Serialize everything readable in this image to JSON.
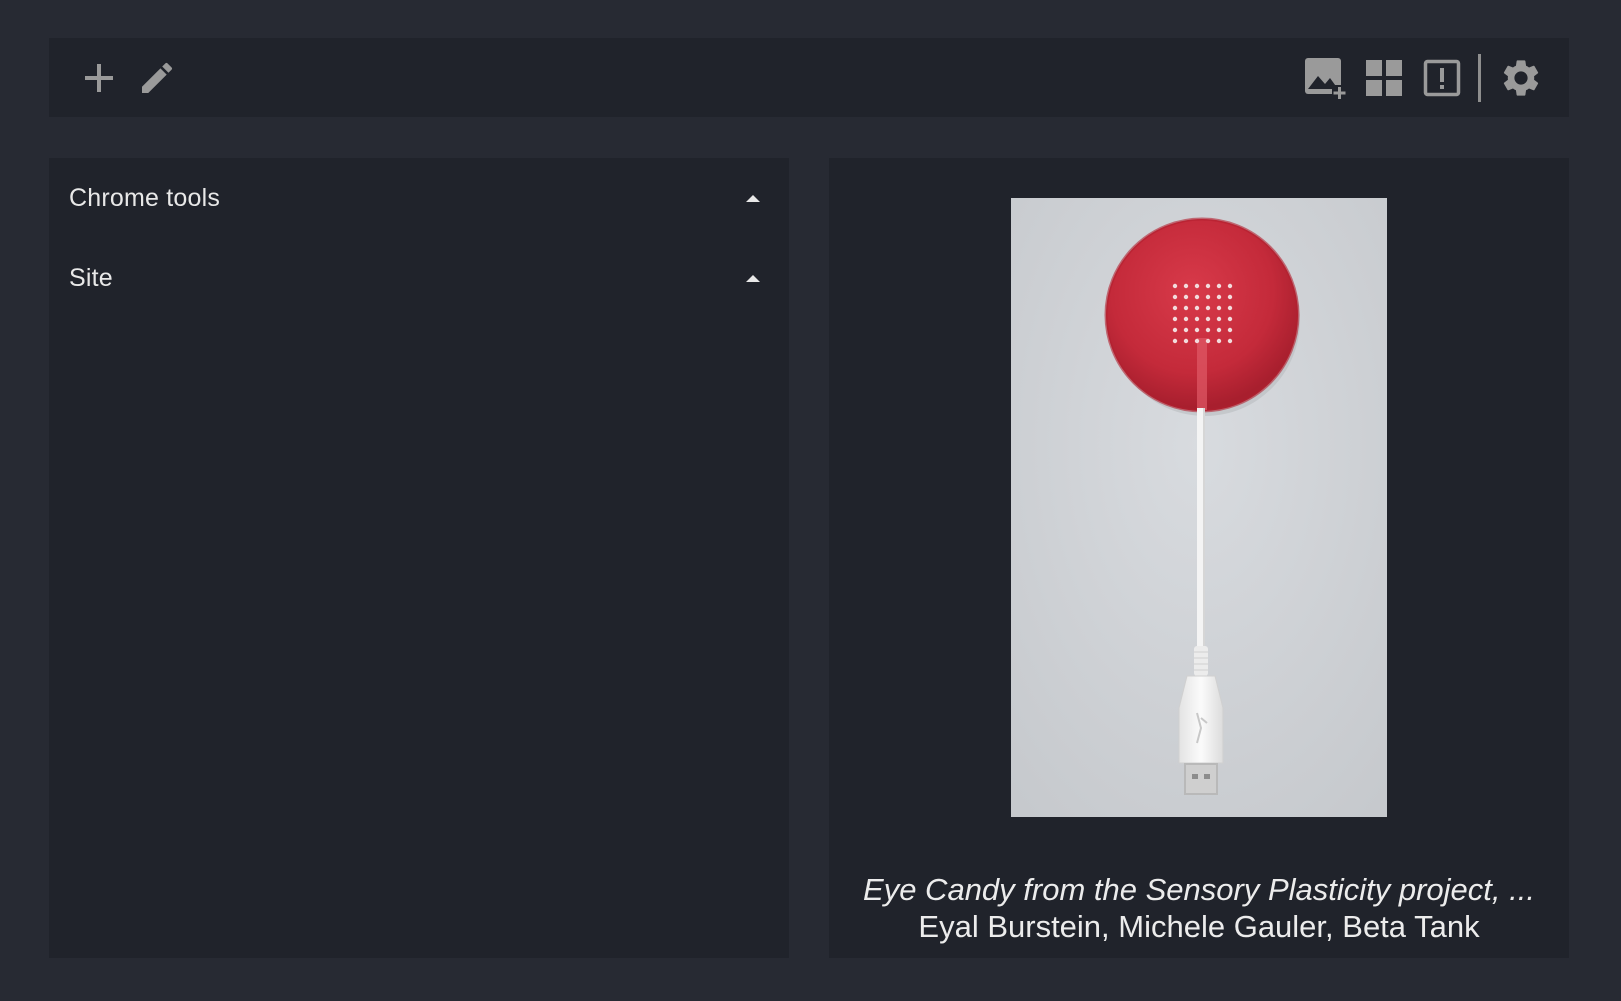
{
  "toolbar": {
    "left_icons": [
      "add-icon",
      "edit-pencil-icon"
    ],
    "right_icons": [
      "add-image-icon",
      "grid-view-icon",
      "report-icon",
      "settings-gear-icon"
    ]
  },
  "sidebar": {
    "sections": [
      {
        "label": "Chrome tools",
        "icon": "caret-up-icon"
      },
      {
        "label": "Site",
        "icon": "caret-up-icon"
      }
    ]
  },
  "artwork": {
    "title": "Eye Candy from the Sensory Plasticity project, ...",
    "artists": "Eyal Burstein, Michele Gauler, Beta Tank",
    "colors": {
      "background": "#cfd2d6",
      "candy": "#c92d3d",
      "stick": "#f3f3f3"
    }
  },
  "theme": {
    "page_bg": "#272a33",
    "panel_bg": "#20232b",
    "icon": "#9a9a9a"
  }
}
